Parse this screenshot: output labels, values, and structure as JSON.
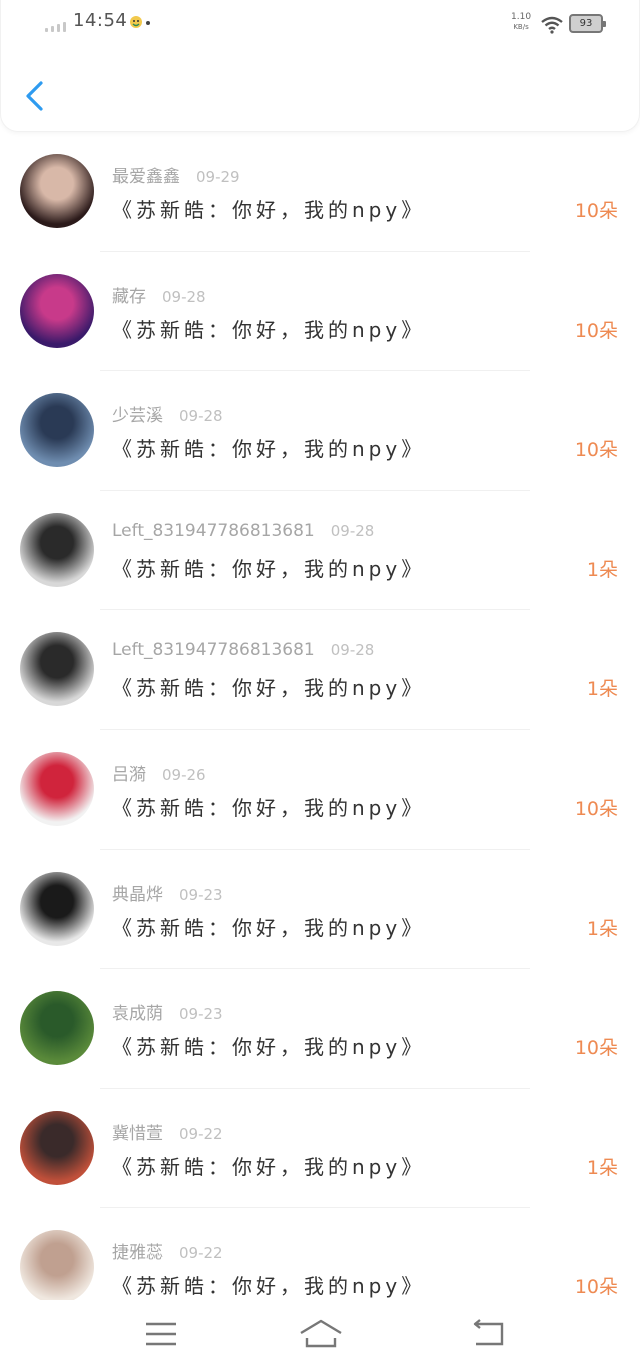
{
  "status_bar": {
    "time": "14:54",
    "net_speed_value": "1.10",
    "net_speed_unit": "KB/s",
    "battery": "93"
  },
  "list": [
    {
      "name": "最爱鑫鑫",
      "date": "09-29",
      "message": "《苏新皓：你好，我的npy》",
      "count": "10朵",
      "avatar_colors": [
        "#2b1a1a",
        "#d8b8a8"
      ]
    },
    {
      "name": "藏存",
      "date": "09-28",
      "message": "《苏新皓：你好，我的npy》",
      "count": "10朵",
      "avatar_colors": [
        "#3a1a6a",
        "#c83a8a"
      ]
    },
    {
      "name": "少芸溪",
      "date": "09-28",
      "message": "《苏新皓：你好，我的npy》",
      "count": "10朵",
      "avatar_colors": [
        "#6f8db0",
        "#2a3a55"
      ]
    },
    {
      "name": "Left_831947786813681",
      "date": "09-28",
      "message": "《苏新皓：你好，我的npy》",
      "count": "1朵",
      "avatar_colors": [
        "#d8d8d8",
        "#2a2a2a"
      ]
    },
    {
      "name": "Left_831947786813681",
      "date": "09-28",
      "message": "《苏新皓：你好，我的npy》",
      "count": "1朵",
      "avatar_colors": [
        "#d8d8d8",
        "#2a2a2a"
      ]
    },
    {
      "name": "吕漪",
      "date": "09-26",
      "message": "《苏新皓：你好，我的npy》",
      "count": "10朵",
      "avatar_colors": [
        "#f2f2f2",
        "#d0243c"
      ]
    },
    {
      "name": "典晶烨",
      "date": "09-23",
      "message": "《苏新皓：你好，我的npy》",
      "count": "1朵",
      "avatar_colors": [
        "#e8e8e8",
        "#1a1a1a"
      ]
    },
    {
      "name": "袁成荫",
      "date": "09-23",
      "message": "《苏新皓：你好，我的npy》",
      "count": "10朵",
      "avatar_colors": [
        "#5a8a3a",
        "#2a5a2a"
      ]
    },
    {
      "name": "冀惜萱",
      "date": "09-22",
      "message": "《苏新皓：你好，我的npy》",
      "count": "1朵",
      "avatar_colors": [
        "#c0503a",
        "#3a2a2a"
      ]
    },
    {
      "name": "捷雅蕊",
      "date": "09-22",
      "message": "《苏新皓：你好，我的npy》",
      "count": "10朵",
      "avatar_colors": [
        "#f0e8e0",
        "#c0a090"
      ]
    }
  ],
  "nav": {
    "menu_icon": "menu-icon",
    "home_icon": "home-icon",
    "back_icon": "back-icon"
  },
  "colors": {
    "accent_blue": "#2e9bf0",
    "count_orange": "#ee8a52"
  }
}
